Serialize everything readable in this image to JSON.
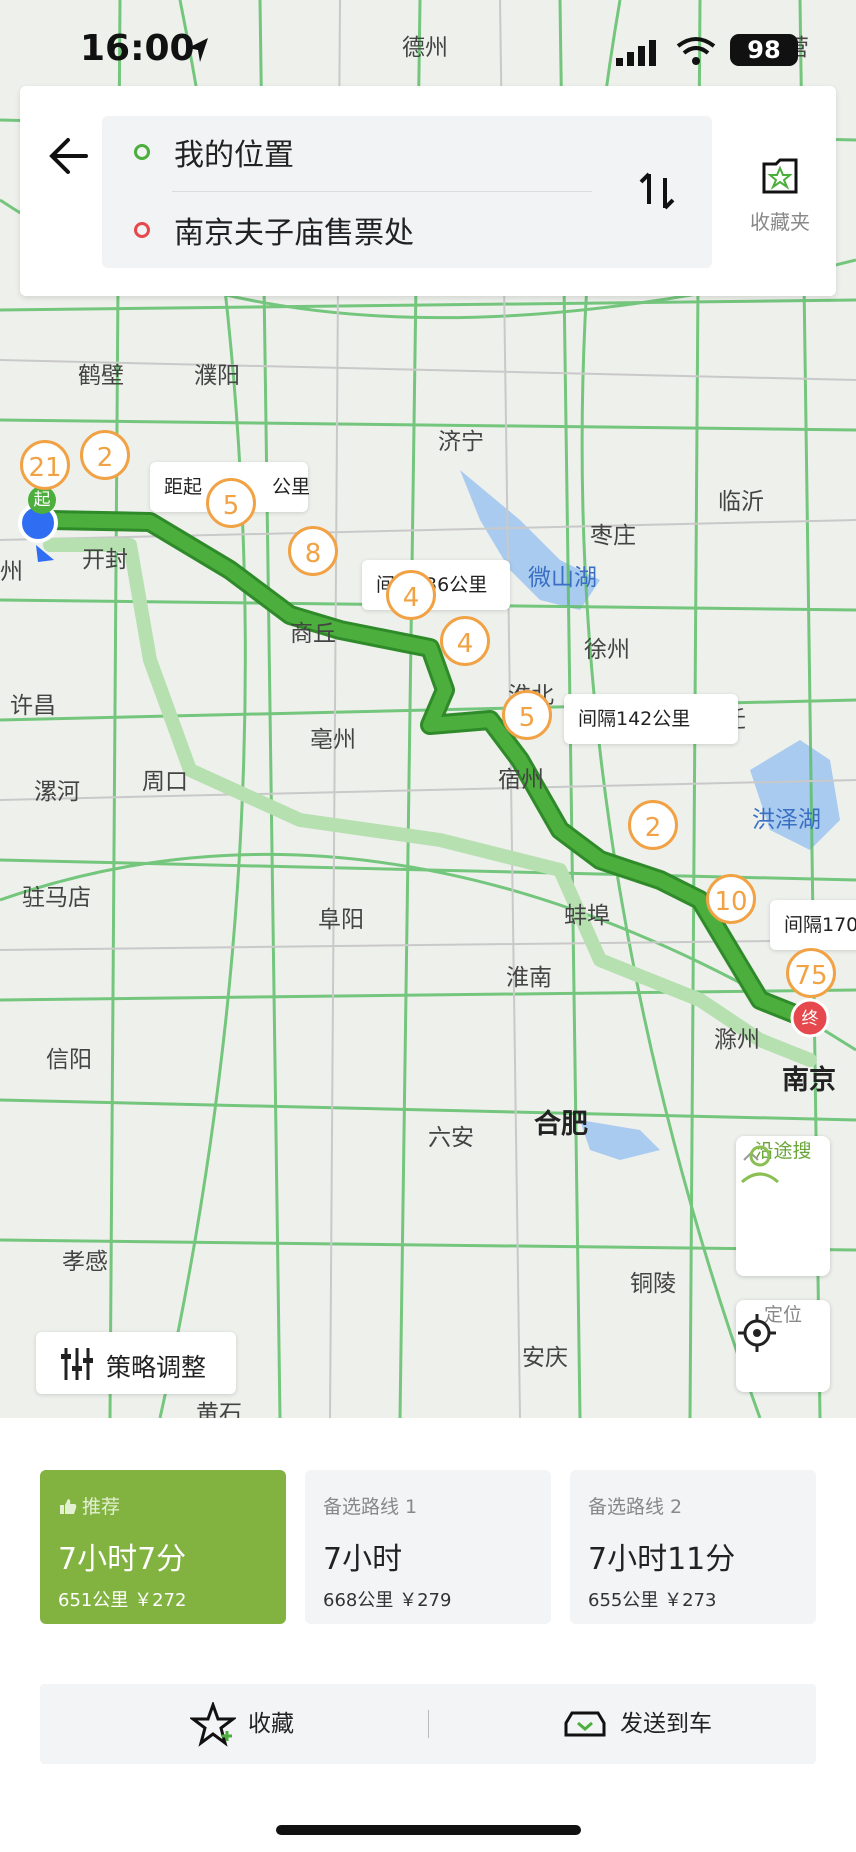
{
  "status": {
    "time": "16:00",
    "battery": "98"
  },
  "search": {
    "origin": "我的位置",
    "destination": "南京夫子庙售票处",
    "favorites_label": "收藏夹"
  },
  "map": {
    "cities": [
      {
        "name": "德州"
      },
      {
        "name": "营"
      },
      {
        "name": "鹤壁"
      },
      {
        "name": "濮阳"
      },
      {
        "name": "济宁"
      },
      {
        "name": "临沂"
      },
      {
        "name": "枣庄"
      },
      {
        "name": "开封"
      },
      {
        "name": "商丘"
      },
      {
        "name": "徐州"
      },
      {
        "name": "许昌"
      },
      {
        "name": "亳州"
      },
      {
        "name": "宿州"
      },
      {
        "name": "宿迁"
      },
      {
        "name": "漯河"
      },
      {
        "name": "周口"
      },
      {
        "name": "驻马店"
      },
      {
        "name": "阜阳"
      },
      {
        "name": "蚌埠"
      },
      {
        "name": "淮南"
      },
      {
        "name": "滁州"
      },
      {
        "name": "南京"
      },
      {
        "name": "信阳"
      },
      {
        "name": "六安"
      },
      {
        "name": "合肥"
      },
      {
        "name": "孝感"
      },
      {
        "name": "铜陵"
      },
      {
        "name": "安庆"
      },
      {
        "name": "黄石"
      },
      {
        "name": "州"
      },
      {
        "name": "淮北"
      },
      {
        "name": "微山湖"
      },
      {
        "name": "洪泽湖"
      }
    ],
    "markers": [
      "21",
      "2",
      "5",
      "8",
      "4",
      "4",
      "5",
      "2",
      "10",
      "75"
    ],
    "callouts": [
      "距起",
      "公里",
      "间",
      "36公里",
      "间隔142公里",
      "间隔170"
    ],
    "start_badge": "起",
    "end_badge": "终",
    "along_route_label": "沿途搜",
    "locate_label": "定位",
    "strategy_label": "策略调整"
  },
  "routes": [
    {
      "tag": "推荐",
      "duration": "7小时7分",
      "info": "651公里 ￥272",
      "active": true
    },
    {
      "tag": "备选路线 1",
      "duration": "7小时",
      "info": "668公里 ￥279",
      "active": false
    },
    {
      "tag": "备选路线 2",
      "duration": "7小时11分",
      "info": "655公里 ￥273",
      "active": false
    }
  ],
  "actions": {
    "favorite": "收藏",
    "send_to_car": "发送到车"
  },
  "colors": {
    "accent": "#82b341",
    "route": "#4cae3c",
    "alt_route": "#b6e0b0",
    "marker": "#f0a245"
  }
}
